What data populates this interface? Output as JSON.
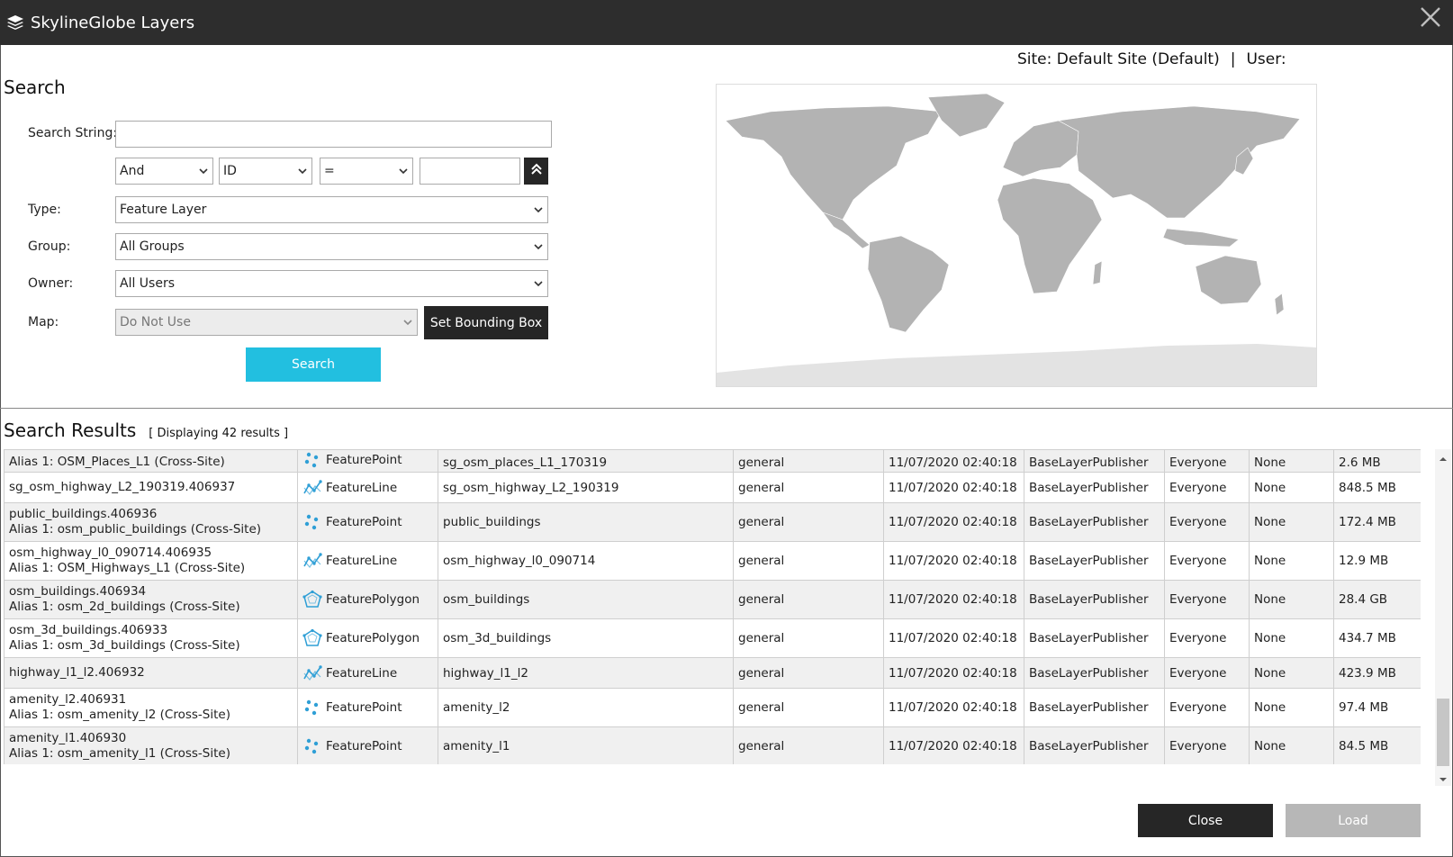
{
  "window": {
    "title": "SkylineGlobe Layers"
  },
  "site": {
    "site_label": "Site: Default Site (Default)",
    "separator": "|",
    "user_label": "User:"
  },
  "search": {
    "title": "Search",
    "search_string_label": "Search String:",
    "search_string_value": "",
    "logic_value": "And",
    "field_value": "ID",
    "operator_value": "=",
    "criteria_value": "",
    "type_label": "Type:",
    "type_value": "Feature Layer",
    "group_label": "Group:",
    "group_value": "All Groups",
    "owner_label": "Owner:",
    "owner_value": "All Users",
    "map_label": "Map:",
    "map_value": "Do Not Use",
    "bbox_button": "Set Bounding Box",
    "search_button": "Search"
  },
  "results": {
    "title": "Search Results",
    "count_text": "[ Displaying 42 results ]",
    "rows": [
      {
        "name": "",
        "alias": "Alias 1: OSM_Places_L1 (Cross-Site)",
        "type": "FeaturePoint",
        "icon": "feature-point-icon",
        "layer": "sg_osm_places_L1_170319",
        "category": "general",
        "date": "11/07/2020 02:40:18",
        "owner": "BaseLayerPublisher",
        "access": "Everyone",
        "policy": "None",
        "size": "2.6 MB",
        "partial": true
      },
      {
        "name": "sg_osm_highway_L2_190319.406937",
        "alias": "",
        "type": "FeatureLine",
        "icon": "feature-line-icon",
        "layer": "sg_osm_highway_L2_190319",
        "category": "general",
        "date": "11/07/2020 02:40:18",
        "owner": "BaseLayerPublisher",
        "access": "Everyone",
        "policy": "None",
        "size": "848.5 MB"
      },
      {
        "name": "public_buildings.406936",
        "alias": "Alias 1: osm_public_buildings (Cross-Site)",
        "type": "FeaturePoint",
        "icon": "feature-point-icon",
        "layer": "public_buildings",
        "category": "general",
        "date": "11/07/2020 02:40:18",
        "owner": "BaseLayerPublisher",
        "access": "Everyone",
        "policy": "None",
        "size": "172.4 MB"
      },
      {
        "name": "osm_highway_l0_090714.406935",
        "alias": "Alias 1: OSM_Highways_L1 (Cross-Site)",
        "type": "FeatureLine",
        "icon": "feature-line-icon",
        "layer": "osm_highway_l0_090714",
        "category": "general",
        "date": "11/07/2020 02:40:18",
        "owner": "BaseLayerPublisher",
        "access": "Everyone",
        "policy": "None",
        "size": "12.9 MB"
      },
      {
        "name": "osm_buildings.406934",
        "alias": "Alias 1: osm_2d_buildings (Cross-Site)",
        "type": "FeaturePolygon",
        "icon": "feature-polygon-icon",
        "layer": "osm_buildings",
        "category": "general",
        "date": "11/07/2020 02:40:18",
        "owner": "BaseLayerPublisher",
        "access": "Everyone",
        "policy": "None",
        "size": "28.4 GB"
      },
      {
        "name": "osm_3d_buildings.406933",
        "alias": "Alias 1: osm_3d_buildings (Cross-Site)",
        "type": "FeaturePolygon",
        "icon": "feature-polygon-icon",
        "layer": "osm_3d_buildings",
        "category": "general",
        "date": "11/07/2020 02:40:18",
        "owner": "BaseLayerPublisher",
        "access": "Everyone",
        "policy": "None",
        "size": "434.7 MB"
      },
      {
        "name": "highway_l1_l2.406932",
        "alias": "",
        "type": "FeatureLine",
        "icon": "feature-line-icon",
        "layer": "highway_l1_l2",
        "category": "general",
        "date": "11/07/2020 02:40:18",
        "owner": "BaseLayerPublisher",
        "access": "Everyone",
        "policy": "None",
        "size": "423.9 MB"
      },
      {
        "name": "amenity_l2.406931",
        "alias": "Alias 1: osm_amenity_l2 (Cross-Site)",
        "type": "FeaturePoint",
        "icon": "feature-point-icon",
        "layer": "amenity_l2",
        "category": "general",
        "date": "11/07/2020 02:40:18",
        "owner": "BaseLayerPublisher",
        "access": "Everyone",
        "policy": "None",
        "size": "97.4 MB"
      },
      {
        "name": "amenity_l1.406930",
        "alias": "Alias 1: osm_amenity_l1 (Cross-Site)",
        "type": "FeaturePoint",
        "icon": "feature-point-icon",
        "layer": "amenity_l1",
        "category": "general",
        "date": "11/07/2020 02:40:18",
        "owner": "BaseLayerPublisher",
        "access": "Everyone",
        "policy": "None",
        "size": "84.5 MB"
      }
    ]
  },
  "footer": {
    "close_button": "Close",
    "load_button": "Load"
  },
  "colors": {
    "titlebar": "#2d2d2d",
    "accent": "#22bfe0",
    "icon": "#2f9fd6",
    "dark_button": "#262626",
    "disabled_button": "#b7b7b7"
  }
}
